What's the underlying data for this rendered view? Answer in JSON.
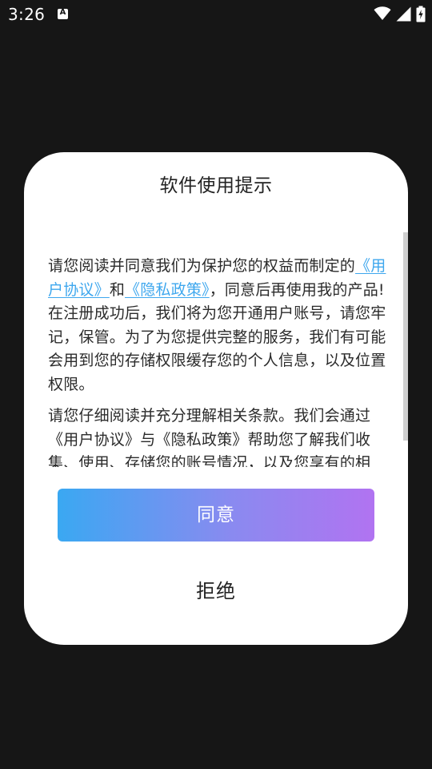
{
  "status_bar": {
    "time": "3:26",
    "notification_icon_letter": "A",
    "icons": [
      "wifi-icon",
      "signal-icon",
      "battery-icon"
    ]
  },
  "dialog": {
    "title": "软件使用提示",
    "paragraph1": {
      "prefix": "请您阅读并同意我们为保护您的权益而制定的",
      "link1": "《用户协议》",
      "connector": "和",
      "link2": "《隐私政策》",
      "suffix": "，同意后再使用我的产品!在注册成功后，我们将为您开通用户账号，请您牢记，保管。为了为您提供完整的服务，我们有可能会用到您的存储权限缓存您的个人信息，以及位置权限。"
    },
    "paragraph2": "请您仔细阅读并充分理解相关条款。我们会通过《用户协议》与《隐私政策》帮助您了解我们收集、使用、存储您的账号情况，以及您享有的相",
    "agree_label": "同意",
    "reject_label": "拒绝"
  },
  "colors": {
    "background": "#161616",
    "dialog": "#ffffff",
    "link": "#3ea7ee",
    "button_gradient_start": "#3aa8f2",
    "button_gradient_end": "#b173f1"
  }
}
